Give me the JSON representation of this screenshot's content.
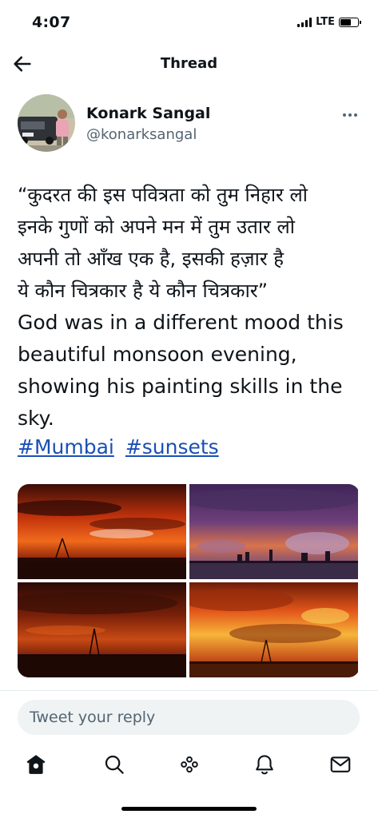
{
  "status_bar": {
    "time": "4:07",
    "network": "LTE"
  },
  "header": {
    "title": "Thread",
    "back_icon": "arrow-left-icon"
  },
  "author": {
    "name": "Konark Sangal",
    "handle": "@konarksangal",
    "more_icon": "more-horizontal-icon"
  },
  "tweet": {
    "hindi_lines": [
      "“कुदरत की इस पवित्रता को तुम निहार लो",
      "इनके गुणों को अपने मन में तुम उतार लो",
      "अपनी तो आँख एक है, इसकी हज़ार है",
      "ये कौन चित्रकार है ये कौन चित्रकार”"
    ],
    "english_lines": [
      "God was in a different mood this",
      "beautiful monsoon evening,",
      "showing his painting skills in the",
      "sky."
    ],
    "hashtags": [
      "#Mumbai",
      "#sunsets"
    ]
  },
  "media": {
    "photo_count": 4
  },
  "reply": {
    "placeholder": "Tweet your reply"
  },
  "tab_bar": {
    "icons": [
      "home-icon",
      "search-icon",
      "spaces-icon",
      "notifications-icon",
      "messages-icon"
    ]
  },
  "colors": {
    "text": "#0f1419",
    "secondary": "#536471",
    "link": "#1a4fb5",
    "reply_bg": "#eff3f4"
  }
}
